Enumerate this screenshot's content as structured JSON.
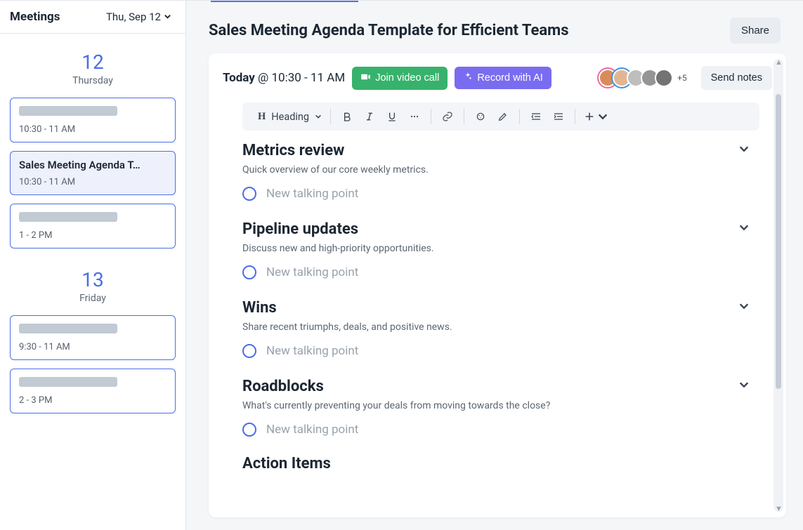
{
  "sidebar": {
    "title": "Meetings",
    "current_date_label": "Thu, Sep 12",
    "days": [
      {
        "num": "12",
        "name": "Thursday",
        "events": [
          {
            "title": "",
            "placeholder": true,
            "time": "10:30 - 11 AM",
            "selected": false
          },
          {
            "title": "Sales Meeting Agenda T…",
            "placeholder": false,
            "time": "10:30 - 11 AM",
            "selected": true
          },
          {
            "title": "",
            "placeholder": true,
            "time": "1 - 2 PM",
            "selected": false
          }
        ]
      },
      {
        "num": "13",
        "name": "Friday",
        "events": [
          {
            "title": "",
            "placeholder": true,
            "time": "9:30 - 11 AM",
            "selected": false
          },
          {
            "title": "",
            "placeholder": true,
            "time": "2 - 3 PM",
            "selected": false
          }
        ]
      }
    ]
  },
  "page": {
    "title": "Sales Meeting Agenda Template for Efficient Teams",
    "share_label": "Share"
  },
  "meeting": {
    "today_label": "Today",
    "time_label": "@ 10:30 - 11 AM",
    "join_label": "Join video call",
    "record_label": "Record with AI",
    "avatar_overflow": "+5",
    "send_notes_label": "Send notes"
  },
  "toolbar": {
    "heading_label": "Heading"
  },
  "sections": [
    {
      "title": "Metrics review",
      "desc": "Quick overview of our core weekly metrics.",
      "new_point": "New talking point"
    },
    {
      "title": "Pipeline updates",
      "desc": "Discuss new and high-priority opportunities.",
      "new_point": "New talking point"
    },
    {
      "title": "Wins",
      "desc": "Share recent triumphs, deals, and positive news.",
      "new_point": "New talking point"
    },
    {
      "title": "Roadblocks",
      "desc": "What's currently preventing your deals from moving towards the close?",
      "new_point": "New talking point"
    }
  ],
  "cutoff_title": "Action Items"
}
